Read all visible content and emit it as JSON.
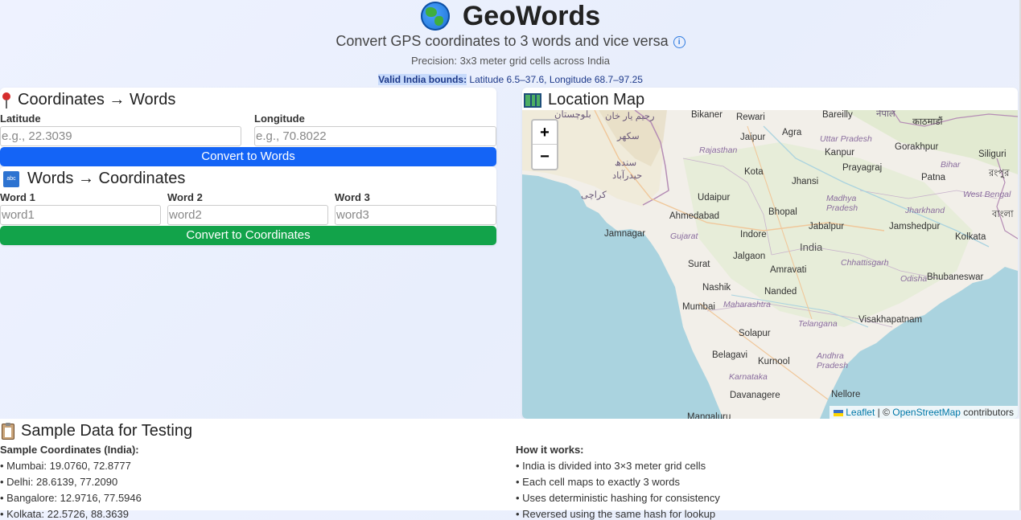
{
  "header": {
    "title": "GeoWords",
    "subtitle": "Convert GPS coordinates to 3 words and vice versa",
    "precision": "Precision: 3x3 meter grid cells across India",
    "bounds_label": "Valid India bounds:",
    "bounds_value": " Latitude 6.5–37.6, Longitude 68.7–97.25"
  },
  "coords_to_words": {
    "title": "Coordinates → Words",
    "lat_label": "Latitude",
    "lat_placeholder": "e.g., 22.3039",
    "lng_label": "Longitude",
    "lng_placeholder": "e.g., 70.8022",
    "button": "Convert to Words"
  },
  "words_to_coords": {
    "title": "Words → Coordinates",
    "word1_label": "Word 1",
    "word1_placeholder": "word1",
    "word2_label": "Word 2",
    "word2_placeholder": "word2",
    "word3_label": "Word 3",
    "word3_placeholder": "word3",
    "button": "Convert to Coordinates"
  },
  "map": {
    "title": "Location Map",
    "zoom_in": "+",
    "zoom_out": "−",
    "attribution_leaflet": "Leaflet",
    "attribution_sep": " | © ",
    "attribution_osm": "OpenStreetMap",
    "attribution_tail": " contributors",
    "places": {
      "bikaner": "Bikaner",
      "rewari": "Rewari",
      "bareilly": "Bareilly",
      "nepal": "नेपाल",
      "rahim": "رحیم یار خان",
      "baluch": "بلوچستان",
      "jaipur": "Jaipur",
      "agra": "Agra",
      "kathmandu": "काठमाडौं",
      "sukkur": "سکھر",
      "uttar": "Uttar Pradesh",
      "rajasthan": "Rajasthan",
      "kanpur": "Kanpur",
      "gorakhpur": "Gorakhpur",
      "siliguri": "Siliguri",
      "sindh": "سندھ",
      "hyderabad_pk": "حیدرآباد",
      "kota": "Kota",
      "prayagraj": "Prayagraj",
      "bihar": "Bihar",
      "rangpur": "রংপুর",
      "karachi": "کراچی",
      "udaipur": "Udaipur",
      "jhansi": "Jhansi",
      "patna": "Patna",
      "mp": "Madhya Pradesh",
      "wb": "West Bengal",
      "ahmedabad": "Ahmedabad",
      "bhopal": "Bhopal",
      "jharkhand": "Jharkhand",
      "bangla": "বাংলা",
      "jamnagar": "Jamnagar",
      "gujarat": "Gujarat",
      "indore": "Indore",
      "jabalpur": "Jabalpur",
      "jamshedpur": "Jamshedpur",
      "kolkata": "Kolkata",
      "india": "India",
      "jalgaon": "Jalgaon",
      "surat": "Surat",
      "chhattisgarh": "Chhattisgarh",
      "amravati": "Amravati",
      "odisha": "Odisha",
      "bhubaneswar": "Bhubaneswar",
      "nashik": "Nashik",
      "nanded": "Nanded",
      "maharashtra": "Maharashtra",
      "mumbai": "Mumbai",
      "telangana": "Telangana",
      "visakhapatnam": "Visakhapatnam",
      "solapur": "Solapur",
      "belagavi": "Belagavi",
      "andhra": "Andhra Pradesh",
      "kurnool": "Kurnool",
      "karnataka": "Karnataka",
      "davanagere": "Davanagere",
      "nellore": "Nellore",
      "mangaluru": "Mangaluru"
    }
  },
  "sample": {
    "title": "Sample Data for Testing",
    "coords_heading": "Sample Coordinates (India):",
    "coords": [
      "• Mumbai: 19.0760, 72.8777",
      "• Delhi: 28.6139, 77.2090",
      "• Bangalore: 12.9716, 77.5946",
      "• Kolkata: 22.5726, 88.3639"
    ],
    "how_heading": "How it works:",
    "how": [
      "• India is divided into 3×3 meter grid cells",
      "• Each cell maps to exactly 3 words",
      "• Uses deterministic hashing for consistency",
      "• Reversed using the same hash for lookup"
    ]
  }
}
